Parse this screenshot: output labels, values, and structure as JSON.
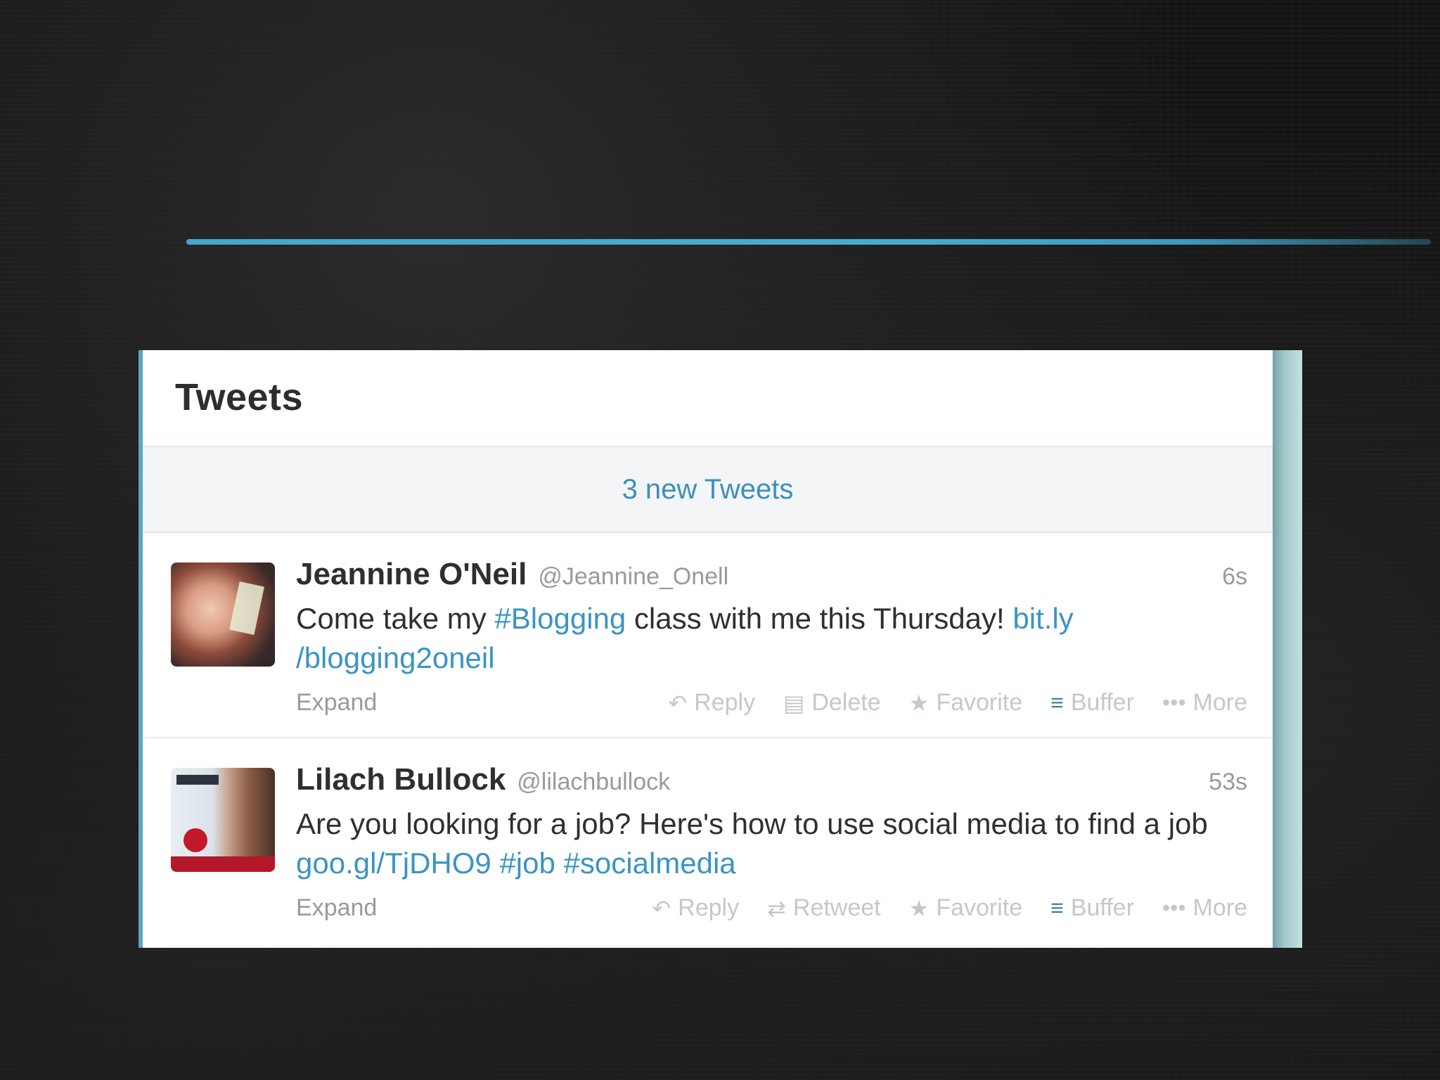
{
  "panel": {
    "title": "Tweets",
    "new_tweets_label": "3 new Tweets"
  },
  "tweets": [
    {
      "name": "Jeannine O'Neil",
      "handle": "@Jeannine_Onell",
      "time": "6s",
      "text_segments": [
        "Come take my ",
        "#Blogging",
        " class with me this Thursday!  ",
        "bit.ly /blogging2oneil"
      ],
      "expand_label": "Expand",
      "actions": {
        "reply": "Reply",
        "delete": "Delete",
        "favorite": "Favorite",
        "buffer": "Buffer",
        "more": "More"
      }
    },
    {
      "name": "Lilach Bullock",
      "handle": "@lilachbullock",
      "time": "53s",
      "text_segments": [
        "Are you looking for a job? Here's how to use social media to find a job ",
        "goo.gl/TjDHO9",
        " ",
        "#job",
        " ",
        "#socialmedia"
      ],
      "expand_label": "Expand",
      "actions": {
        "reply": "Reply",
        "retweet": "Retweet",
        "favorite": "Favorite",
        "buffer": "Buffer",
        "more": "More"
      }
    }
  ],
  "icons": {
    "reply": "reply-arrow-icon",
    "delete": "trash-icon",
    "retweet": "retweet-icon",
    "favorite": "star-icon",
    "buffer": "buffer-stack-icon",
    "more": "ellipsis-icon"
  },
  "colors": {
    "link": "#3b94c3",
    "accent_line": "#49b8e2",
    "text": "#2f2f2f",
    "muted": "#9a9a9a"
  }
}
